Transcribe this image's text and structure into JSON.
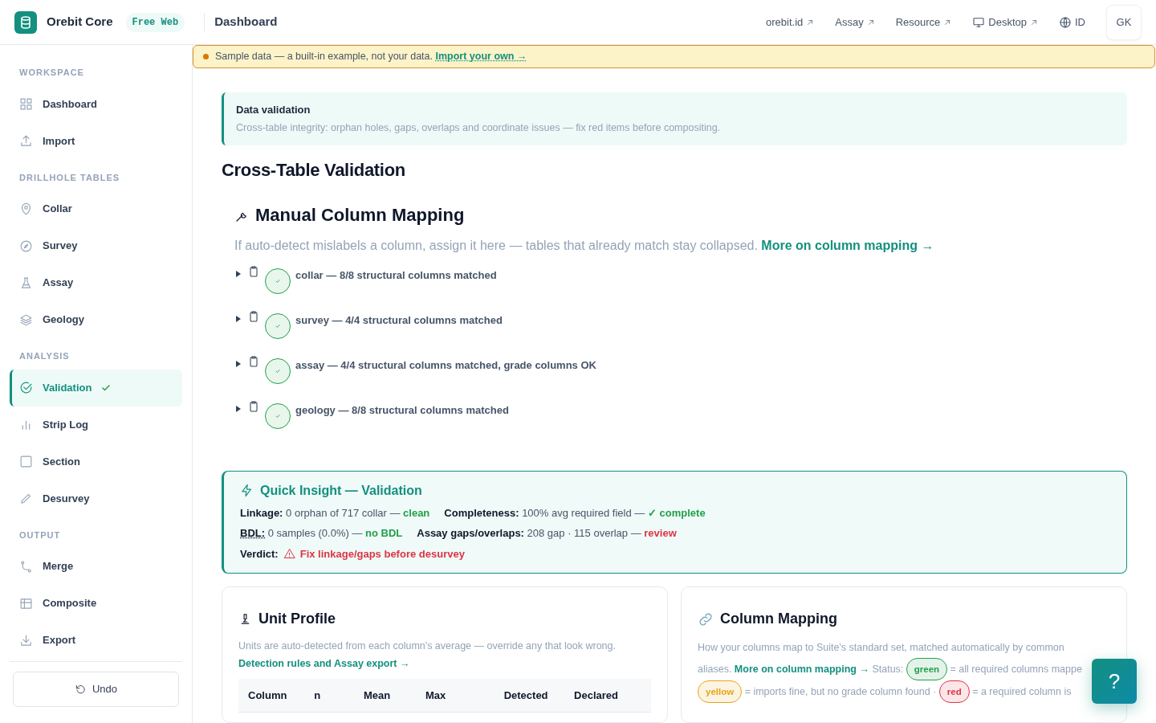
{
  "brand": {
    "name": "Orebit Core",
    "badge": "Free Web"
  },
  "page_title": "Dashboard",
  "top_links": [
    {
      "label": "orebit.id",
      "external": true
    },
    {
      "label": "Assay",
      "external": true
    },
    {
      "label": "Resource",
      "external": true
    },
    {
      "label": "Desktop",
      "external": true
    },
    {
      "label": "ID",
      "external": false
    }
  ],
  "avatar": "GK",
  "sidebar": {
    "sections": [
      {
        "title": "WORKSPACE",
        "items": [
          {
            "label": "Dashboard",
            "selected": false
          },
          {
            "label": "Import",
            "selected": false
          }
        ]
      },
      {
        "title": "DRILLHOLE TABLES",
        "items": [
          {
            "label": "Collar",
            "selected": false
          },
          {
            "label": "Survey",
            "selected": false
          },
          {
            "label": "Assay",
            "selected": false
          },
          {
            "label": "Geology",
            "selected": false
          }
        ]
      },
      {
        "title": "ANALYSIS",
        "items": [
          {
            "label": "Validation",
            "selected": true
          },
          {
            "label": "Strip Log",
            "selected": false
          },
          {
            "label": "Section",
            "selected": false
          },
          {
            "label": "Desurvey",
            "selected": false
          }
        ]
      },
      {
        "title": "OUTPUT",
        "items": [
          {
            "label": "Merge",
            "selected": false
          },
          {
            "label": "Composite",
            "selected": false
          },
          {
            "label": "Export",
            "selected": false
          }
        ]
      }
    ],
    "undo": "Undo"
  },
  "notice": {
    "text": "Sample data — a built-in example, not your data.",
    "link": "Import your own →"
  },
  "info": {
    "title": "Data validation",
    "text": "Cross-table integrity: orphan holes, gaps, overlaps and coordinate issues — fix red items before compositing."
  },
  "heading": "Cross-Table Validation",
  "mapping": {
    "title": "Manual Column Mapping",
    "intro": "If auto-detect mislabels a column, assign it here — tables that already match stay collapsed.",
    "link": "More on column mapping →",
    "tables": [
      {
        "text": "collar — 8/8 structural columns matched",
        "expanded": false,
        "matched": true
      },
      {
        "text": "survey — 4/4 structural columns matched",
        "expanded": false,
        "matched": true
      },
      {
        "text": "assay — 4/4 structural columns matched, grade columns OK",
        "expanded": false,
        "matched": true
      },
      {
        "text": "geology — 8/8 structural columns matched",
        "expanded": false,
        "matched": true
      }
    ]
  },
  "insight": {
    "title": "Quick Insight — Validation",
    "lines": [
      [
        {
          "label": "Linkage:",
          "text": "0 orphan of 717 collar —",
          "result": "clean",
          "warning": false
        },
        {
          "label": "Completeness:",
          "text": "100% avg required field —",
          "result": "✓ complete",
          "warning": false
        }
      ],
      [
        {
          "label": "BDL:",
          "text": "0 samples (0.0%) —",
          "result": "no BDL",
          "warning": false
        },
        {
          "label": "Assay gaps/overlaps:",
          "text": "208 gap · 115 overlap —",
          "result": "review",
          "warning": true
        }
      ]
    ],
    "verdict": {
      "label": "Verdict:",
      "text": "Fix linkage/gaps before desurvey",
      "warning": true
    }
  },
  "unit_profile": {
    "title": "Unit Profile",
    "text": "Units are auto-detected from each column's average — override any that look wrong.",
    "link": "Detection rules and Assay export →",
    "columns": [
      "Column",
      "n",
      "Mean",
      "Max",
      "Detected",
      "Declared"
    ]
  },
  "column_mapping": {
    "title": "Column Mapping",
    "text": "How your columns map to Suite's standard set, matched automatically by common aliases.",
    "link": "More on column mapping →",
    "status_label": "Status:",
    "legend": [
      {
        "label": "green",
        "color": "#22a04b",
        "text": "= all required columns mappe"
      },
      {
        "label": "yellow",
        "color": "#e8a317",
        "text": "= imports fine, but no grade column found ·"
      },
      {
        "label": "red",
        "color": "#dc3545",
        "text": "= a required column is"
      }
    ]
  },
  "help": "?"
}
